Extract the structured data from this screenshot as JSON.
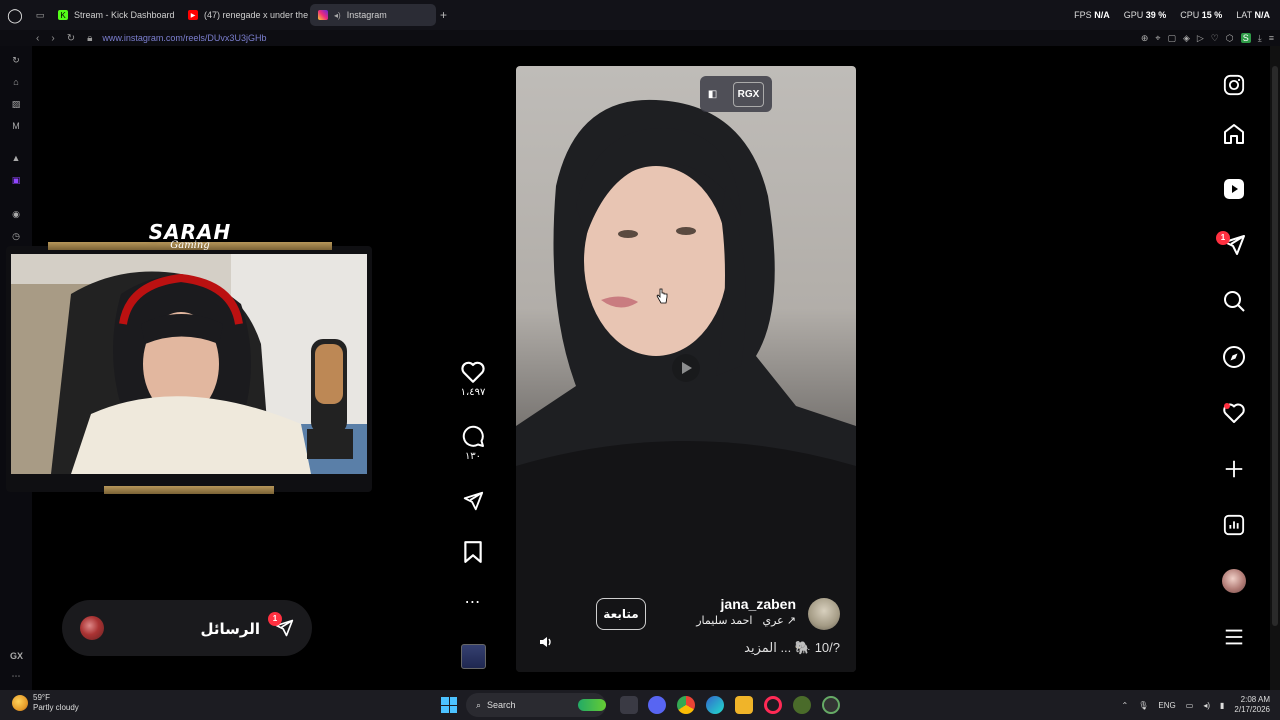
{
  "browser": {
    "tabs": [
      {
        "label": "Stream - Kick Dashboard",
        "icon": "kick-icon",
        "active": false
      },
      {
        "label": "(47) renegade x under the",
        "icon": "youtube-icon",
        "active": false
      },
      {
        "label": "Instagram",
        "icon": "instagram-icon",
        "active": true
      }
    ],
    "new_tab": "+",
    "stats": {
      "fps_label": "FPS",
      "fps_value": "N/A",
      "gpu_label": "GPU",
      "gpu_value": "39 %",
      "cpu_label": "CPU",
      "cpu_value": "15 %",
      "lat_label": "LAT",
      "lat_value": "N/A"
    },
    "url": "www.instagram.com/reels/DUvx3U3jGHb"
  },
  "sidebar": {
    "bottom_label": "GX",
    "icons": [
      "refresh-icon",
      "bag-icon",
      "shop-icon",
      "m-icon",
      "aria-icon",
      "twitch-icon",
      "player-icon",
      "history-icon",
      "more-icon"
    ]
  },
  "overlay": {
    "brand_title": "SARAH",
    "brand_sub": "Gaming"
  },
  "messages": {
    "label": "الرسائل",
    "badge": "1"
  },
  "reel": {
    "rgx_label": "RGX",
    "likes": "١،٤٩٧",
    "comments": "١٣٠",
    "follow_label": "متابعة",
    "username": "jana_zaben",
    "audio": "احمد سليمار",
    "original": "↗ عري",
    "caption": "?/10 🐘 ... المزيد"
  },
  "right_nav": {
    "messages_badge": "1"
  },
  "taskbar": {
    "weather_temp": "59°F",
    "weather_desc": "Partly cloudy",
    "search_label": "Search",
    "lang": "ENG",
    "time": "2:08 AM",
    "date": "2/17/2026"
  },
  "colors": {
    "accent": "#ff3040",
    "tab_active": "#2b2c35",
    "url": "#7c7fd0"
  }
}
